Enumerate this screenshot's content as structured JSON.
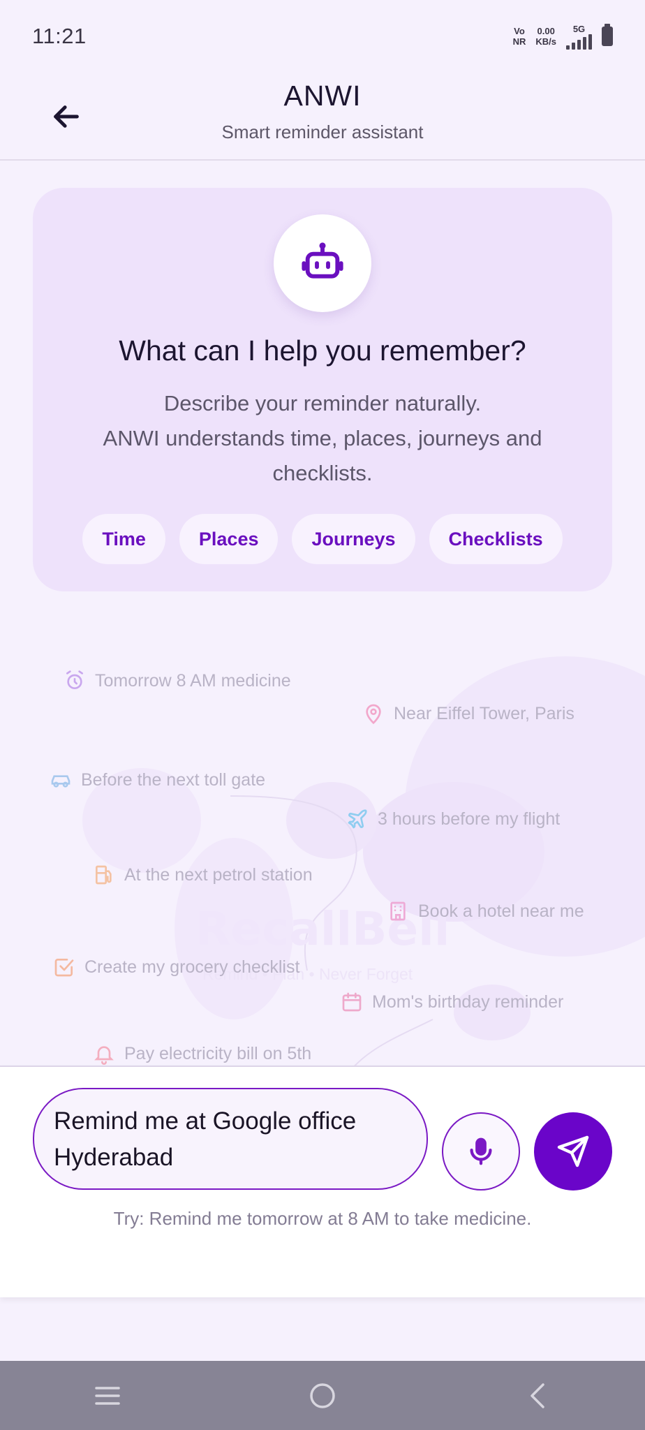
{
  "status_bar": {
    "time": "11:21",
    "volte_top": "Vo",
    "volte_bottom": "NR",
    "speed_value": "0.00",
    "speed_unit": "KB/s",
    "network": "5G"
  },
  "header": {
    "title": "ANWI",
    "subtitle": "Smart reminder assistant",
    "back_icon": "arrow-left-icon"
  },
  "hero": {
    "icon": "robot-icon",
    "title": "What can I help you remember?",
    "description_line1": "Describe your reminder naturally.",
    "description_line2": "ANWI understands time, places, journeys and checklists.",
    "chips": [
      "Time",
      "Places",
      "Journeys",
      "Checklists"
    ]
  },
  "background": {
    "watermark": "RecallBell",
    "watermark_sub": "Remind • Plan • Never Forget",
    "examples": [
      {
        "text": "Tomorrow 8 AM medicine",
        "icon": "alarm-clock-icon",
        "color": "#c9a7ee"
      },
      {
        "text": "Near Eiffel Tower, Paris",
        "icon": "map-pin-icon",
        "color": "#f2a7cb"
      },
      {
        "text": "Before the next toll gate",
        "icon": "car-icon",
        "color": "#a9c9ee"
      },
      {
        "text": "3 hours before my flight",
        "icon": "airplane-icon",
        "color": "#8fcdf0"
      },
      {
        "text": "At the next petrol station",
        "icon": "fuel-pump-icon",
        "color": "#f4c2a3"
      },
      {
        "text": "Book a hotel near me",
        "icon": "hotel-building-icon",
        "color": "#eeaad6"
      },
      {
        "text": "Create my grocery checklist",
        "icon": "checkbox-icon",
        "color": "#f4b9a0"
      },
      {
        "text": "Mom's birthday reminder",
        "icon": "calendar-icon",
        "color": "#eea9cb"
      },
      {
        "text": "Pay electricity bill on 5th",
        "icon": "bell-icon",
        "color": "#f4aebf"
      }
    ]
  },
  "composer": {
    "input_value": "Remind me at Google office Hyderabad",
    "mic_icon": "microphone-icon",
    "send_icon": "send-icon",
    "hint": "Try: Remind me tomorrow at 8 AM to take medicine."
  },
  "colors": {
    "accent": "#6a05c9",
    "background": "#f6f1fd",
    "card": "#eee2fb",
    "chip_text": "#6a0fbf"
  }
}
